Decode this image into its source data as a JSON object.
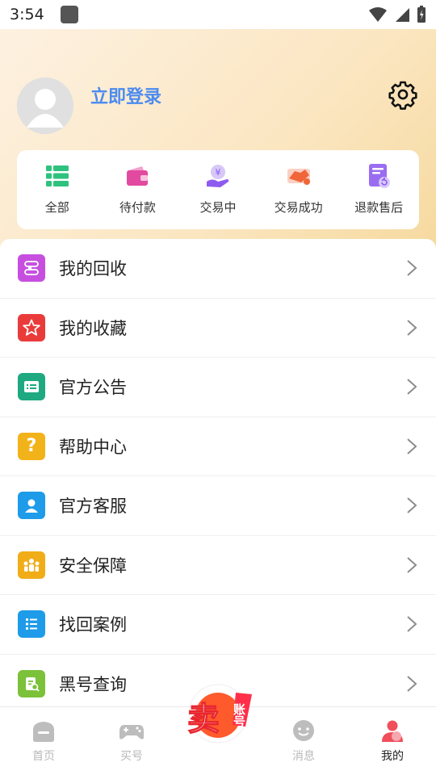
{
  "status_bar": {
    "time": "3:54"
  },
  "profile": {
    "login_text": "立即登录"
  },
  "orders": [
    {
      "label": "全部",
      "icon": "list-icon"
    },
    {
      "label": "待付款",
      "icon": "wallet-icon"
    },
    {
      "label": "交易中",
      "icon": "yen-hand-icon"
    },
    {
      "label": "交易成功",
      "icon": "handshake-icon"
    },
    {
      "label": "退款售后",
      "icon": "refund-doc-icon"
    }
  ],
  "menu": [
    {
      "label": "我的回收",
      "icon": "recycle-icon",
      "color": "#c64fe0"
    },
    {
      "label": "我的收藏",
      "icon": "star-icon",
      "color": "#ea3b3b"
    },
    {
      "label": "官方公告",
      "icon": "announcement-icon",
      "color": "#1ea981"
    },
    {
      "label": "帮助中心",
      "icon": "question-icon",
      "color": "#f2b21a"
    },
    {
      "label": "官方客服",
      "icon": "customer-service-icon",
      "color": "#1e9be9"
    },
    {
      "label": "安全保障",
      "icon": "shield-people-icon",
      "color": "#f0ad18"
    },
    {
      "label": "找回案例",
      "icon": "list-case-icon",
      "color": "#1e9be9"
    },
    {
      "label": "黑号查询",
      "icon": "blacklist-search-icon",
      "color": "#7bc13a"
    }
  ],
  "tabs": {
    "home": "首页",
    "buy": "买号",
    "sell_badge_main": "卖",
    "sell_badge_sub": "账号",
    "messages": "消息",
    "mine": "我的"
  },
  "colors": {
    "accent": "#4b8bf0",
    "order_green": "#2ec27e",
    "order_pink": "#e24aa0",
    "order_purple": "#8e5bf0",
    "order_orange": "#f0663a",
    "active_tab": "#f04e5a"
  }
}
